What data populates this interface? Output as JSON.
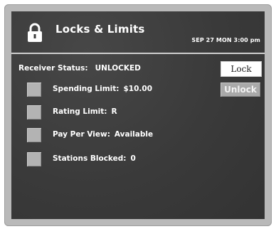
{
  "header": {
    "title": "Locks & Limits",
    "date_time": "SEP 27 MON  3:00 pm"
  },
  "receiver": {
    "label": "Receiver Status:",
    "value": "UNLOCKED"
  },
  "buttons": {
    "lock": "Lock",
    "unlock": "Unlock"
  },
  "limits": [
    {
      "label": "Spending Limit:",
      "value": "$10.00"
    },
    {
      "label": "Rating Limit:",
      "value": "R"
    },
    {
      "label": "Pay Per View:",
      "value": "Available"
    },
    {
      "label": "Stations Blocked:",
      "value": "0"
    }
  ],
  "icons": {
    "header": "padlock-icon"
  },
  "colors": {
    "screen_background": "#3c3c3c",
    "bezel": "#b9b9b9",
    "text": "#ffffff",
    "lock_button": "#ffffff",
    "unlock_button": "#a9a9a9",
    "checkbox": "#b3b3b3"
  }
}
